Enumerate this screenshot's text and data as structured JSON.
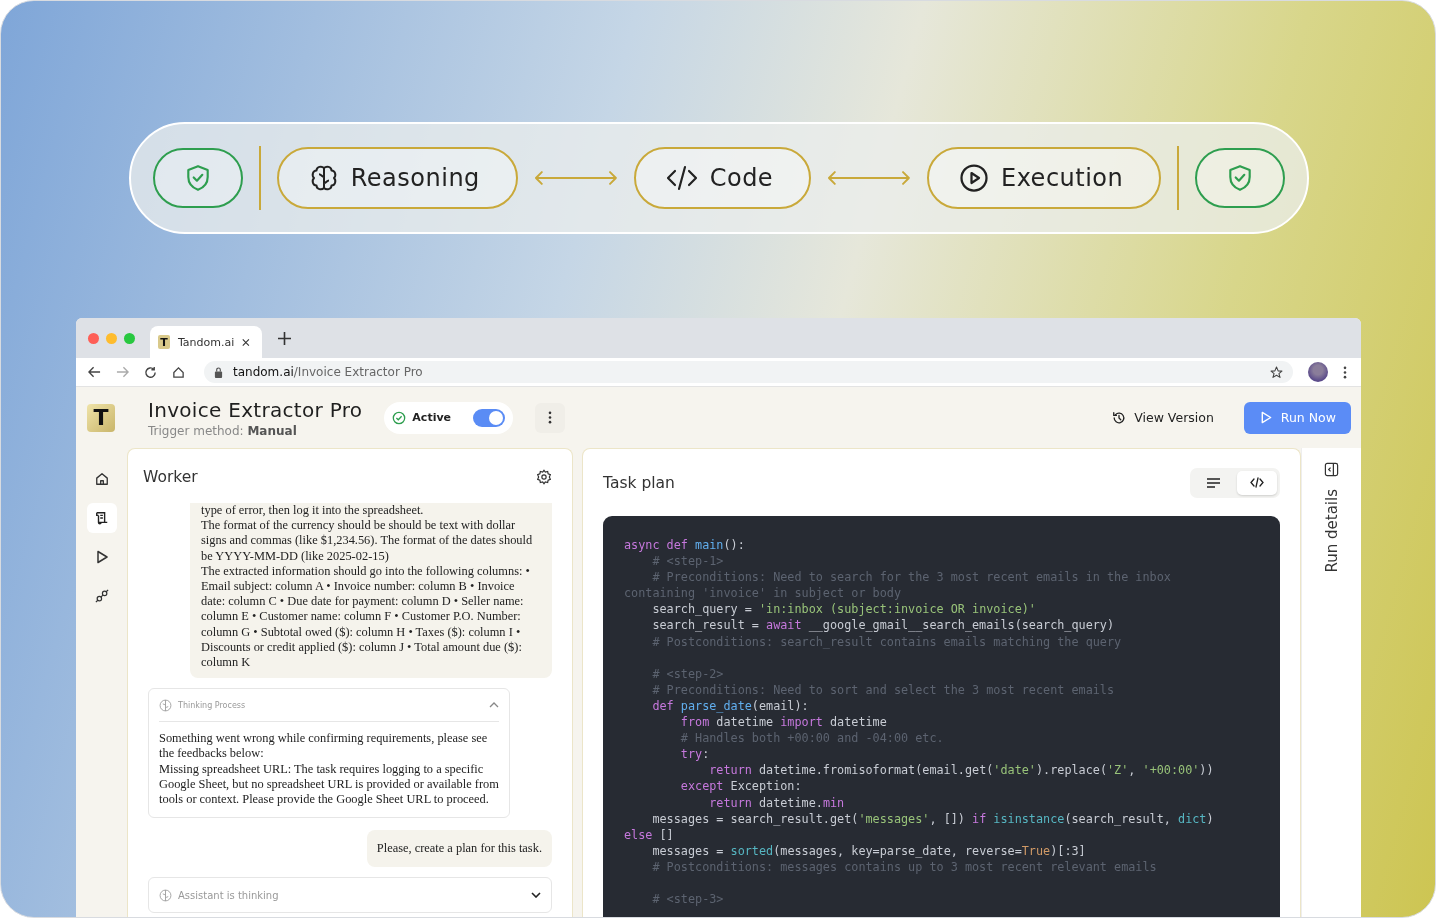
{
  "flow": [
    {
      "kind": "shield"
    },
    {
      "kind": "divider"
    },
    {
      "kind": "step",
      "label": "Reasoning"
    },
    {
      "kind": "arrow"
    },
    {
      "kind": "step",
      "label": "Code"
    },
    {
      "kind": "arrow"
    },
    {
      "kind": "step",
      "label": "Execution"
    },
    {
      "kind": "divider"
    },
    {
      "kind": "shield"
    }
  ],
  "browser": {
    "tab": {
      "favicon": "T",
      "title": "Tandom.ai"
    },
    "url_host": "tandom.ai",
    "url_path": "/Invoice Extractor Pro"
  },
  "header": {
    "logo": "T",
    "title": "Invoice Extractor Pro",
    "trigger_label": "Trigger method:",
    "trigger_value": "Manual",
    "status": "Active",
    "active_on": true,
    "view_version": "View Version",
    "run_now": "Run Now"
  },
  "rail": [
    {
      "kind": "home",
      "selected": false
    },
    {
      "kind": "scroll",
      "selected": true
    },
    {
      "kind": "play",
      "selected": false
    },
    {
      "kind": "plug",
      "selected": false
    }
  ],
  "worker": {
    "title": "Worker",
    "message": [
      "type of error, then log it into the spreadsheet.",
      "The format of the currency should be should be text with dollar signs and commas (like $1,234.56). The format of the dates should be YYYY-MM-DD (like 2025-02-15)",
      "The extracted information should go into the following columns: • Email subject: column A • Invoice number: column B • Invoice date: column C • Due date for payment: column D • Seller name: column E • Customer name: column F • Customer P.O. Number: column G • Subtotal owed ($): column H • Taxes ($): column I • Discounts or credit applied ($): column J • Total amount due ($): column K"
    ],
    "thinking": {
      "label": "Thinking Process",
      "expanded": true,
      "text": [
        "Something went wrong while confirming requirements, please see the feedbacks below:",
        "Missing spreadsheet URL: The task requires logging to a specific Google Sheet, but no spreadsheet URL is provided or available from tools or context. Please provide the Google Sheet URL to proceed."
      ]
    },
    "user_message": "Please, create a plan for this task.",
    "assistant": {
      "label": "Assistant is thinking",
      "expanded": false
    }
  },
  "task_plan": {
    "title": "Task plan",
    "views": [
      {
        "kind": "text",
        "selected": false
      },
      {
        "kind": "code",
        "selected": true
      }
    ],
    "code": [
      {
        "kind": "code",
        "tokens": [
          {
            "kind": "kw",
            "text": "async def "
          },
          {
            "kind": "fn",
            "text": "main"
          },
          {
            "kind": "plain",
            "text": "():"
          }
        ]
      },
      {
        "kind": "code",
        "tokens": [
          {
            "kind": "comment",
            "text": "    # <step-1>"
          }
        ]
      },
      {
        "kind": "code",
        "tokens": [
          {
            "kind": "comment",
            "text": "    # Preconditions: Need to search for the 3 most recent emails in the inbox"
          }
        ]
      },
      {
        "kind": "code",
        "tokens": [
          {
            "kind": "comment",
            "text": "containing 'invoice' in subject or body"
          }
        ]
      },
      {
        "kind": "code",
        "tokens": [
          {
            "kind": "plain",
            "text": "    search_query = "
          },
          {
            "kind": "str",
            "text": "'in:inbox (subject:invoice OR invoice)'"
          }
        ]
      },
      {
        "kind": "code",
        "tokens": [
          {
            "kind": "plain",
            "text": "    search_result = "
          },
          {
            "kind": "kw",
            "text": "await"
          },
          {
            "kind": "plain",
            "text": " __google_gmail__search_emails(search_query)"
          }
        ]
      },
      {
        "kind": "code",
        "tokens": [
          {
            "kind": "comment",
            "text": "    # Postconditions: search_result contains emails matching the query"
          }
        ]
      },
      {
        "kind": "blank"
      },
      {
        "kind": "code",
        "tokens": [
          {
            "kind": "comment",
            "text": "    # <step-2>"
          }
        ]
      },
      {
        "kind": "code",
        "tokens": [
          {
            "kind": "comment",
            "text": "    # Preconditions: Need to sort and select the 3 most recent emails"
          }
        ]
      },
      {
        "kind": "code",
        "tokens": [
          {
            "kind": "kw",
            "text": "    def "
          },
          {
            "kind": "fn",
            "text": "parse_date"
          },
          {
            "kind": "plain",
            "text": "(email):"
          }
        ]
      },
      {
        "kind": "code",
        "tokens": [
          {
            "kind": "kw",
            "text": "        from "
          },
          {
            "kind": "plain",
            "text": "datetime "
          },
          {
            "kind": "kw",
            "text": "import "
          },
          {
            "kind": "plain",
            "text": "datetime"
          }
        ]
      },
      {
        "kind": "code",
        "tokens": [
          {
            "kind": "comment",
            "text": "        # Handles both +00:00 and -04:00 etc."
          }
        ]
      },
      {
        "kind": "code",
        "tokens": [
          {
            "kind": "kw",
            "text": "        try"
          },
          {
            "kind": "plain",
            "text": ":"
          }
        ]
      },
      {
        "kind": "code",
        "tokens": [
          {
            "kind": "kw",
            "text": "            return "
          },
          {
            "kind": "plain",
            "text": "datetime.fromisoformat(email.get("
          },
          {
            "kind": "str",
            "text": "'date'"
          },
          {
            "kind": "plain",
            "text": ").replace("
          },
          {
            "kind": "str",
            "text": "'Z'"
          },
          {
            "kind": "plain",
            "text": ", "
          },
          {
            "kind": "str",
            "text": "'+00:00'"
          },
          {
            "kind": "plain",
            "text": "))"
          }
        ]
      },
      {
        "kind": "code",
        "tokens": [
          {
            "kind": "kw",
            "text": "        except "
          },
          {
            "kind": "plain",
            "text": "Exception:"
          }
        ]
      },
      {
        "kind": "code",
        "tokens": [
          {
            "kind": "kw",
            "text": "            return "
          },
          {
            "kind": "plain",
            "text": "datetime."
          },
          {
            "kind": "kw",
            "text": "min"
          }
        ]
      },
      {
        "kind": "code",
        "tokens": [
          {
            "kind": "plain",
            "text": "    messages = search_result.get("
          },
          {
            "kind": "str",
            "text": "'messages'"
          },
          {
            "kind": "plain",
            "text": ", []) "
          },
          {
            "kind": "kw",
            "text": "if "
          },
          {
            "kind": "builtin",
            "text": "isinstance"
          },
          {
            "kind": "plain",
            "text": "(search_result, "
          },
          {
            "kind": "builtin",
            "text": "dict"
          },
          {
            "kind": "plain",
            "text": ")"
          }
        ]
      },
      {
        "kind": "code",
        "tokens": [
          {
            "kind": "kw",
            "text": "else "
          },
          {
            "kind": "plain",
            "text": "[]"
          }
        ]
      },
      {
        "kind": "code",
        "tokens": [
          {
            "kind": "plain",
            "text": "    messages = "
          },
          {
            "kind": "builtin",
            "text": "sorted"
          },
          {
            "kind": "plain",
            "text": "(messages, key=parse_date, reverse="
          },
          {
            "kind": "const",
            "text": "True"
          },
          {
            "kind": "plain",
            "text": ")[:3]"
          }
        ]
      },
      {
        "kind": "code",
        "tokens": [
          {
            "kind": "comment",
            "text": "    # Postconditions: messages contains up to 3 most recent relevant emails"
          }
        ]
      },
      {
        "kind": "blank"
      },
      {
        "kind": "code",
        "tokens": [
          {
            "kind": "comment",
            "text": "    # <step-3>"
          }
        ]
      }
    ]
  },
  "run_details": {
    "label": "Run details"
  }
}
